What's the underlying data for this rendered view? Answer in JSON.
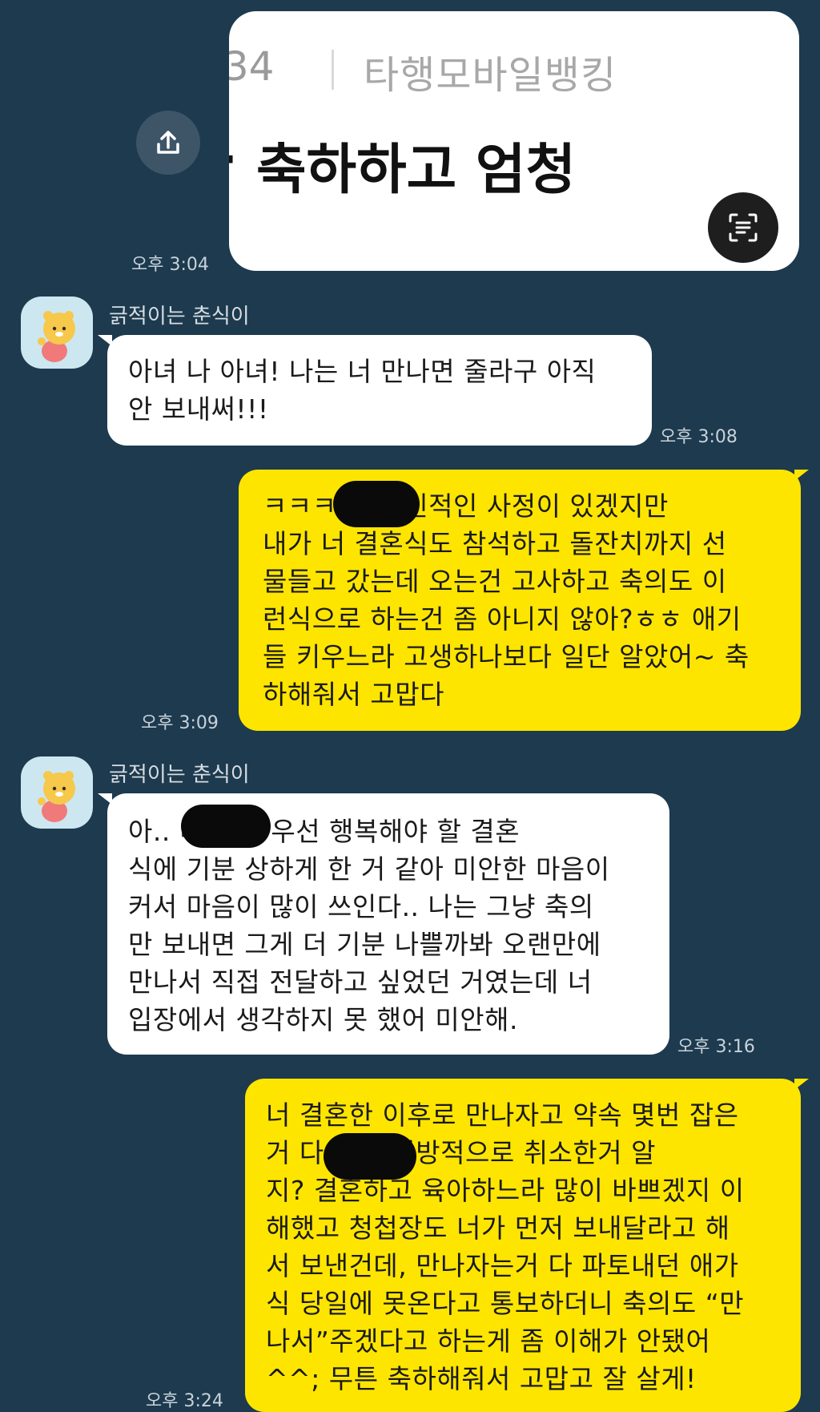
{
  "image_card": {
    "time_fragment": ":34",
    "app_name": "타행모바일뱅킹",
    "left_fragment": "-",
    "headline": "축하하고 엄청"
  },
  "messages": [
    {
      "side": "me",
      "type": "image",
      "time": "오후 3:04"
    },
    {
      "side": "them",
      "sender": "긁적이는 춘식이",
      "time": "오후 3:08",
      "text": "아녀 나 아녀! 나는 너 만나면 줄라구 아직\n안 보내써!!!"
    },
    {
      "side": "me",
      "time": "오후 3:09",
      "text": "ㅋㅋㅋ                  뭐 개인적인 사정이 있겠지만\n내가 너 결혼식도 참석하고 돌잔치까지 선\n물들고 갔는데 오는건 고사하고 축의도 이\n런식으로 하는건 좀 아니지 않아?ㅎㅎ 애기\n들 키우느라 고생하나보다 일단 알았어~ 축\n하해줘서 고맙다"
    },
    {
      "side": "them",
      "sender": "긁적이는 춘식이",
      "time": "오후 3:16",
      "text": "아..                     미안해. 우선 행복해야 할 결혼\n식에 기분 상하게 한 거 같아 미안한 마음이\n커서 마음이 많이 쓰인다.. 나는 그냥 축의\n만 보내면 그게 더 기분 나쁠까봐 오랜만에\n만나서 직접 전달하고 싶었던 거였는데 너\n입장에서 생각하지 못 했어 미안해."
    },
    {
      "side": "me",
      "time": "오후 3:24",
      "text": "너 결혼한 이후로 만나자고 약속 몇번 잡은\n거 다                  너가 일방적으로 취소한거 알\n지? 결혼하고 육아하느라 많이 바쁘겠지 이\n해했고 청첩장도 너가 먼저 보내달라고 해\n서 보낸건데, 만나자는거 다 파토내던 애가\n식 당일에 못온다고 통보하더니 축의도 “만\n나서”주겠다고 하는게 좀 이해가 안됐어\n^^; 무튼 축하해줘서 고맙고 잘 살게!"
    }
  ],
  "icons": {
    "share": "share-icon",
    "scan": "text-scan-icon",
    "avatar": "choonsik-avatar"
  },
  "colors": {
    "background": "#1d3a4f",
    "my_bubble": "#fee500",
    "their_bubble": "#ffffff"
  }
}
